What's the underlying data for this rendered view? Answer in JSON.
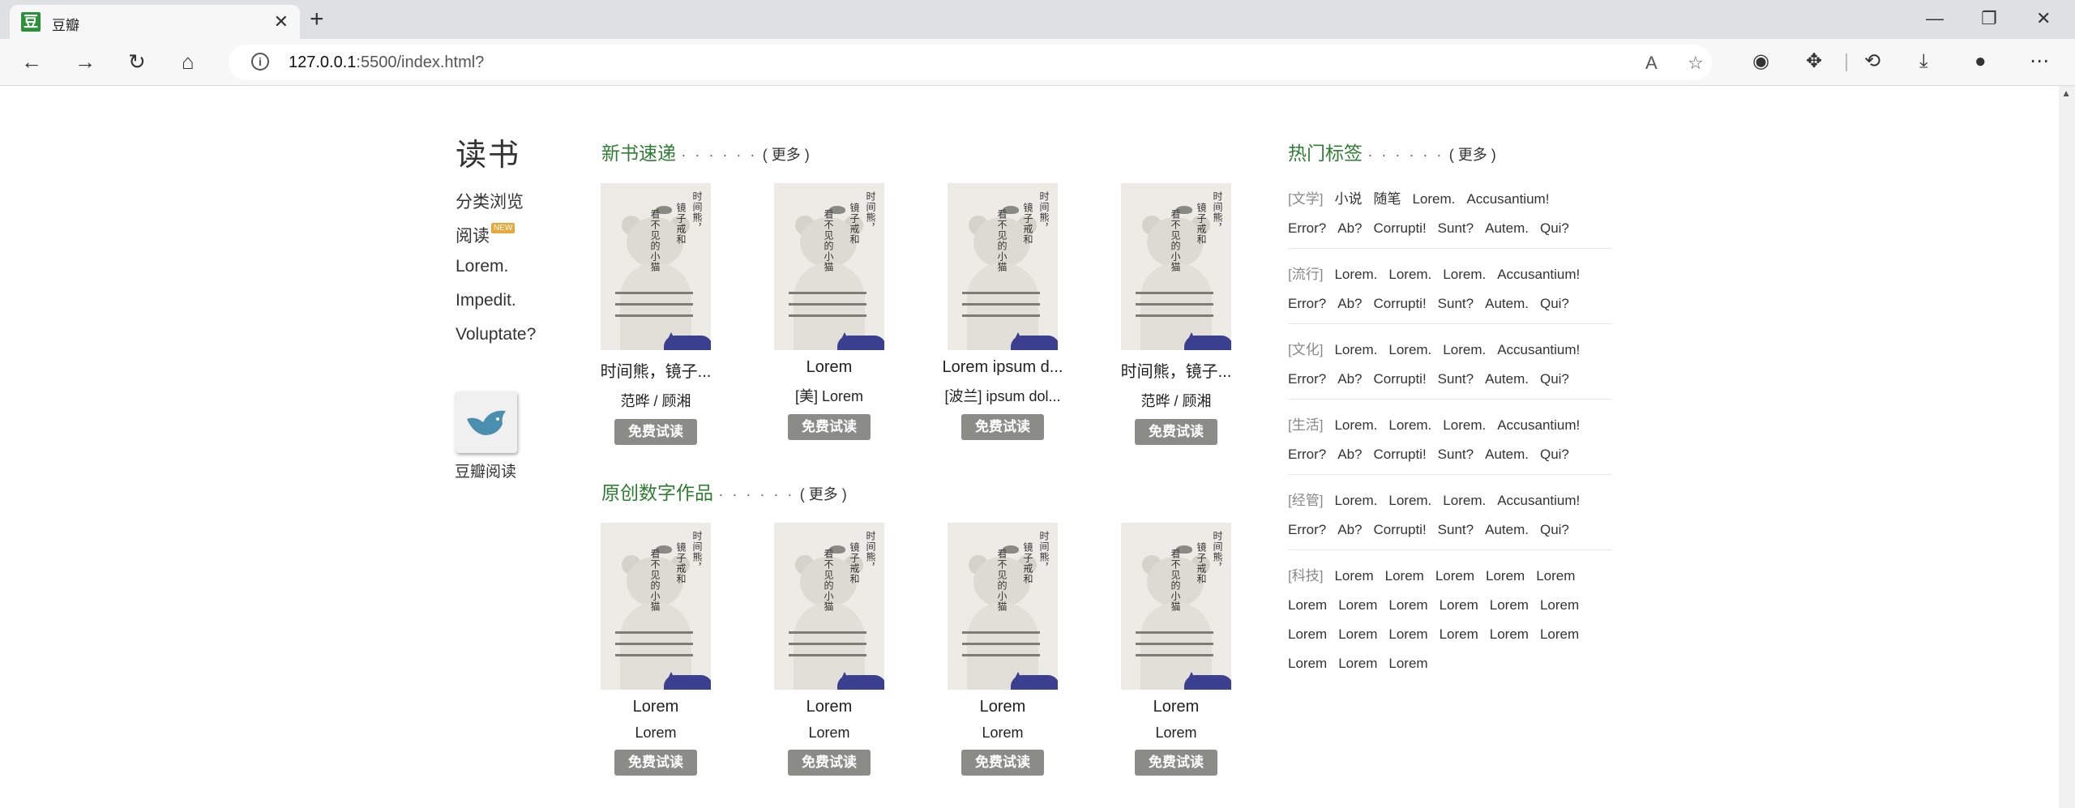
{
  "browser": {
    "tab_title": "豆瓣",
    "favicon_glyph": "豆",
    "url_host": "127.0.0.1",
    "url_rest": ":5500/index.html?"
  },
  "sidebar": {
    "title": "读书",
    "items": [
      "分类浏览",
      "阅读",
      "Lorem.",
      "Impedit.",
      "Voluptate?"
    ],
    "new_badge": "NEW",
    "app_label": "豆瓣阅读"
  },
  "new_books": {
    "heading": "新书速递",
    "dots": "· · · · · ·",
    "more": "( 更多 )",
    "books": [
      {
        "title": "时间熊，镜子...",
        "author": "范晔 / 顾湘",
        "button": "免费试读"
      },
      {
        "title": "Lorem",
        "author": "[美] Lorem",
        "button": "免费试读"
      },
      {
        "title": "Lorem ipsum d...",
        "author": "[波兰] ipsum dol...",
        "button": "免费试读"
      },
      {
        "title": "时间熊，镜子...",
        "author": "范晔 / 顾湘",
        "button": "免费试读"
      }
    ]
  },
  "original_works": {
    "heading": "原创数字作品",
    "dots": "· · · · · ·",
    "more": "( 更多 )",
    "books": [
      {
        "title": "Lorem",
        "author": "Lorem",
        "button": "免费试读"
      },
      {
        "title": "Lorem",
        "author": "Lorem",
        "button": "免费试读"
      },
      {
        "title": "Lorem",
        "author": "Lorem",
        "button": "免费试读"
      },
      {
        "title": "Lorem",
        "author": "Lorem",
        "button": "免费试读"
      }
    ]
  },
  "cover": {
    "vtext_right": "时间熊，",
    "vtext_mid": "镜子戒和",
    "vtext_left": "看不见的小猫"
  },
  "hot_tags": {
    "heading": "热门标签",
    "dots": "· · · · · ·",
    "more": "( 更多 )",
    "groups": [
      {
        "category": "[文学]",
        "rows": [
          [
            "小说",
            "随笔",
            "Lorem.",
            "Accusantium!"
          ],
          [
            "Error?",
            "Ab?",
            "Corrupti!",
            "Sunt?",
            "Autem.",
            "Qui?"
          ]
        ]
      },
      {
        "category": "[流行]",
        "rows": [
          [
            "Lorem.",
            "Lorem.",
            "Lorem.",
            "Accusantium!"
          ],
          [
            "Error?",
            "Ab?",
            "Corrupti!",
            "Sunt?",
            "Autem.",
            "Qui?"
          ]
        ]
      },
      {
        "category": "[文化]",
        "rows": [
          [
            "Lorem.",
            "Lorem.",
            "Lorem.",
            "Accusantium!"
          ],
          [
            "Error?",
            "Ab?",
            "Corrupti!",
            "Sunt?",
            "Autem.",
            "Qui?"
          ]
        ]
      },
      {
        "category": "[生活]",
        "rows": [
          [
            "Lorem.",
            "Lorem.",
            "Lorem.",
            "Accusantium!"
          ],
          [
            "Error?",
            "Ab?",
            "Corrupti!",
            "Sunt?",
            "Autem.",
            "Qui?"
          ]
        ]
      },
      {
        "category": "[经管]",
        "rows": [
          [
            "Lorem.",
            "Lorem.",
            "Lorem.",
            "Accusantium!"
          ],
          [
            "Error?",
            "Ab?",
            "Corrupti!",
            "Sunt?",
            "Autem.",
            "Qui?"
          ]
        ]
      },
      {
        "category": "[科技]",
        "rows": [
          [
            "Lorem",
            "Lorem",
            "Lorem",
            "Lorem",
            "Lorem"
          ],
          [
            "Lorem",
            "Lorem",
            "Lorem",
            "Lorem",
            "Lorem",
            "Lorem"
          ],
          [
            "Lorem",
            "Lorem",
            "Lorem",
            "Lorem",
            "Lorem",
            "Lorem"
          ],
          [
            "Lorem",
            "Lorem",
            "Lorem"
          ]
        ]
      }
    ]
  },
  "colors": {
    "accent_green": "#2e7d32",
    "button_gray": "#8b8b88",
    "cat_blue": "#3a3f8f"
  }
}
